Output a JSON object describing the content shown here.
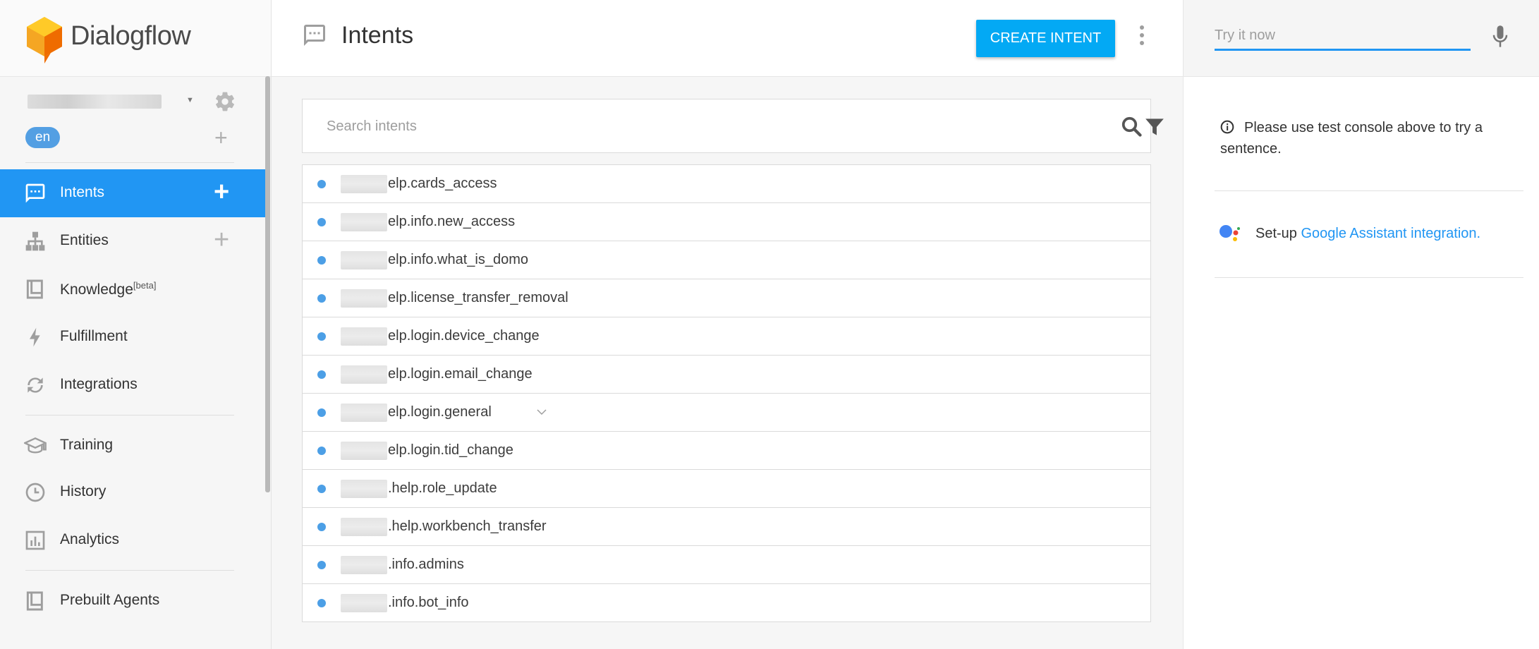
{
  "app": {
    "name": "Dialogflow"
  },
  "sidebar": {
    "language": "en",
    "nav": [
      {
        "label": "Intents",
        "icon": "chat-bubble-icon",
        "active": true,
        "has_add": true
      },
      {
        "label": "Entities",
        "icon": "sitemap-icon",
        "active": false,
        "has_add": true
      },
      {
        "label": "Knowledge",
        "badge": "[beta]",
        "icon": "book-icon",
        "active": false,
        "has_add": false
      },
      {
        "label": "Fulfillment",
        "icon": "bolt-icon",
        "active": false,
        "has_add": false
      },
      {
        "label": "Integrations",
        "icon": "sync-icon",
        "active": false,
        "has_add": false
      },
      {
        "label": "Training",
        "icon": "graduation-cap-icon",
        "active": false,
        "has_add": false
      },
      {
        "label": "History",
        "icon": "clock-icon",
        "active": false,
        "has_add": false
      },
      {
        "label": "Analytics",
        "icon": "bar-chart-icon",
        "active": false,
        "has_add": false
      },
      {
        "label": "Prebuilt Agents",
        "icon": "book-icon",
        "active": false,
        "has_add": false
      }
    ]
  },
  "main": {
    "title": "Intents",
    "create_button": "CREATE INTENT",
    "search_placeholder": "Search intents",
    "intents": [
      {
        "name": "elp.cards_access"
      },
      {
        "name": "elp.info.new_access"
      },
      {
        "name": "elp.info.what_is_domo"
      },
      {
        "name": "elp.license_transfer_removal"
      },
      {
        "name": "elp.login.device_change"
      },
      {
        "name": "elp.login.email_change"
      },
      {
        "name": "elp.login.general",
        "expandable": true
      },
      {
        "name": "elp.login.tid_change"
      },
      {
        "name": ".help.role_update"
      },
      {
        "name": ".help.workbench_transfer"
      },
      {
        "name": ".info.admins"
      },
      {
        "name": ".info.bot_info"
      }
    ]
  },
  "right_panel": {
    "try_placeholder": "Try it now",
    "info_text": "Please use test console above to try a sentence.",
    "assistant_prefix": "Set-up ",
    "assistant_link": "Google Assistant integration."
  },
  "colors": {
    "accent": "#2196f3",
    "create_button": "#03a9f4",
    "intent_dot": "#4c9fe6",
    "logo_orange": "#f5a623"
  }
}
